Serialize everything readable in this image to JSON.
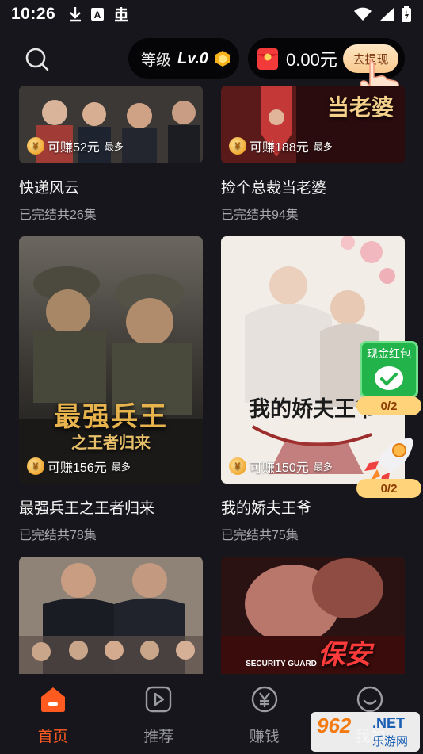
{
  "status_bar": {
    "time": "10:26"
  },
  "header": {
    "level_label": "等级",
    "level_value": "Lv.0",
    "wallet_amount": "0.00元",
    "withdraw_label": "去提现"
  },
  "dramas": [
    {
      "title": "快递风云",
      "subtitle": "已完结共26集",
      "earn": "可赚52元",
      "earn_suffix": "最多",
      "poster_text": ""
    },
    {
      "title": "捡个总裁当老婆",
      "subtitle": "已完结共94集",
      "earn": "可赚188元",
      "earn_suffix": "最多",
      "poster_text": "当老婆"
    },
    {
      "title": "最强兵王之王者归来",
      "subtitle": "已完结共78集",
      "earn": "可赚156元",
      "earn_suffix": "最多",
      "poster_text": "最强兵王",
      "poster_subtext": "之王者归来"
    },
    {
      "title": "我的娇夫王爷",
      "subtitle": "已完结共75集",
      "earn": "可赚150元",
      "earn_suffix": "最多",
      "poster_text": "我的娇夫王爷"
    },
    {
      "title": "",
      "subtitle": "",
      "earn": "",
      "earn_suffix": "",
      "poster_text": ""
    },
    {
      "title": "",
      "subtitle": "",
      "earn": "",
      "earn_suffix": "",
      "poster_text": "保安",
      "poster_subtext": "SECURITY GUARD"
    }
  ],
  "widgets": {
    "red_packet_label": "现金红包",
    "red_packet_count": "0/2",
    "rocket_count": "0/2"
  },
  "nav": [
    {
      "label": "首页",
      "icon": "home-icon",
      "active": true
    },
    {
      "label": "推荐",
      "icon": "play-icon",
      "active": false
    },
    {
      "label": "赚钱",
      "icon": "yuan-icon",
      "active": false
    },
    {
      "label": "我的",
      "icon": "smile-icon",
      "active": false
    }
  ],
  "watermark": {
    "big": "962",
    "net": ".NET",
    "cn": "乐游网"
  },
  "colors": {
    "accent": "#ff5a1f",
    "background": "#16161c",
    "gold": "#f0a830",
    "green": "#22b34a"
  }
}
